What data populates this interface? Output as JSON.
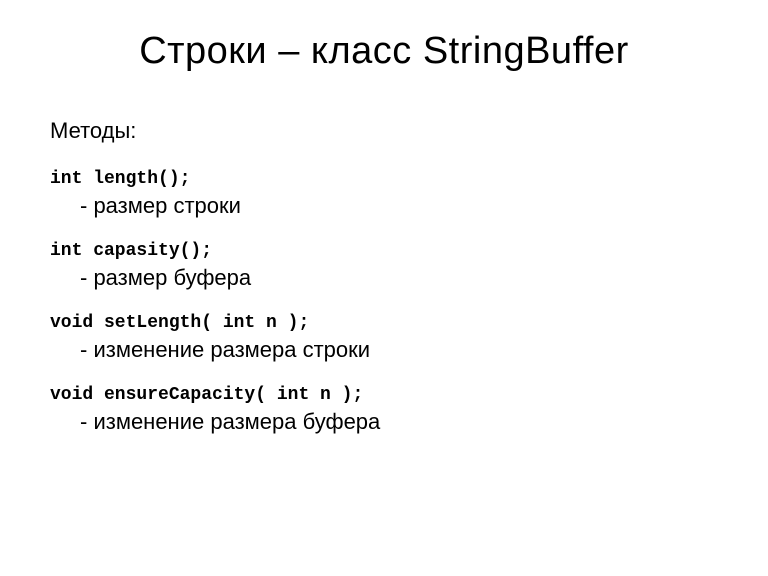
{
  "title": "Строки – класс StringBuffer",
  "subtitle": "Методы:",
  "methods": [
    {
      "sig": "int length();",
      "desc": "- размер строки"
    },
    {
      "sig": "int capasity();",
      "desc": "- размер буфера"
    },
    {
      "sig": "void setLength( int n );",
      "desc": "- изменение размера строки"
    },
    {
      "sig": "void ensureCapacity( int n );",
      "desc": "- изменение размера буфера"
    }
  ]
}
